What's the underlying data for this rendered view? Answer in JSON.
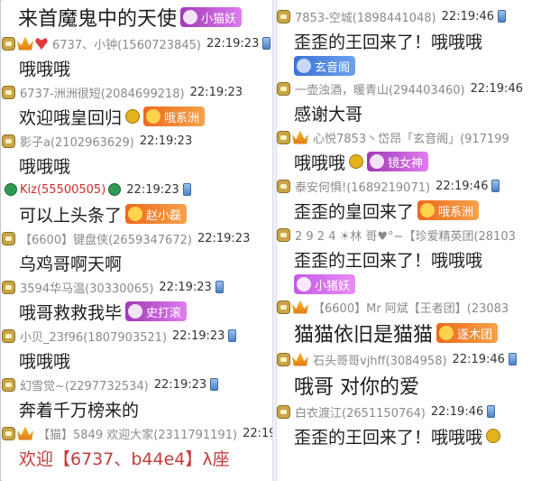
{
  "left_messages": [
    {
      "text": "来首魔鬼中的天使",
      "badge": "小猫妖"
    },
    {
      "user": "6737、小钟(1560723845)",
      "time": "22:19:23",
      "text": "哦哦哦"
    },
    {
      "user": "6737-洲洲很短(2084699218)",
      "time": "22:19:23",
      "text": "欢迎哦皇回归",
      "badge": "哦系洲"
    },
    {
      "user": "影子a(2102963629)",
      "time": "22:19:23",
      "text": "哦哦哦"
    },
    {
      "user": "Kiz(55500505)",
      "time": "22:19:23",
      "text": "可以上头条了",
      "badge": "赵小磊"
    },
    {
      "user": "【6600】键盘侠(2659347672)",
      "time": "22:19:23",
      "text": "乌鸡哥啊天啊"
    },
    {
      "user": "3594华马温(30330065)",
      "time": "22:19:23",
      "text": "哦哥救救我毕",
      "badge": "史打滚"
    },
    {
      "user": "小贝_23f96(1807903521)",
      "time": "22:19:23",
      "text": "哦哦哦"
    },
    {
      "user": "幻雪觉~(2297732534)",
      "time": "22:19:23",
      "text": "奔着千万榜来的"
    },
    {
      "user": "【猫】5849 欢迎大家(2311791191)",
      "time": "22:19:23",
      "text": "欢迎【6737、b44e4】λ座"
    }
  ],
  "right_messages": [
    {
      "user": "7853-空城(1898441048)",
      "time": "22:19:46",
      "text": "歪歪的王回来了！哦哦哦",
      "badge": "玄音阁"
    },
    {
      "user": "一壶浊酒，暖青山(294403460)",
      "time": "22:19:46",
      "text": "感谢大哥"
    },
    {
      "user": "心悦7853丶岱昂「玄音阁」(917199",
      "time": "",
      "text": "哦哦哦",
      "badge": "镜女神"
    },
    {
      "user": "泰安何惧!(1689219071)",
      "time": "22:19:46",
      "text": "歪歪的皇回来了",
      "badge": "哦系洲"
    },
    {
      "user": "2 9 2 4 ☀林 哥♥°~【珍爱精英团(28103",
      "time": "",
      "text": "歪歪的王回来了！哦哦哦",
      "badge": "小猪妖"
    },
    {
      "user": "【6600】Mr 阿斌【王者团】(23083",
      "time": "",
      "text": "猫猫依旧是猫猫",
      "badge": "逐木团"
    },
    {
      "user": "石头哥哥vjhff(3084958)",
      "time": "22:19:46",
      "text": "哦哥 对你的爱"
    },
    {
      "user": "白衣渡江(2651150764)",
      "time": "22:19:46",
      "text": "歪歪的王回来了！哦哦哦"
    }
  ]
}
